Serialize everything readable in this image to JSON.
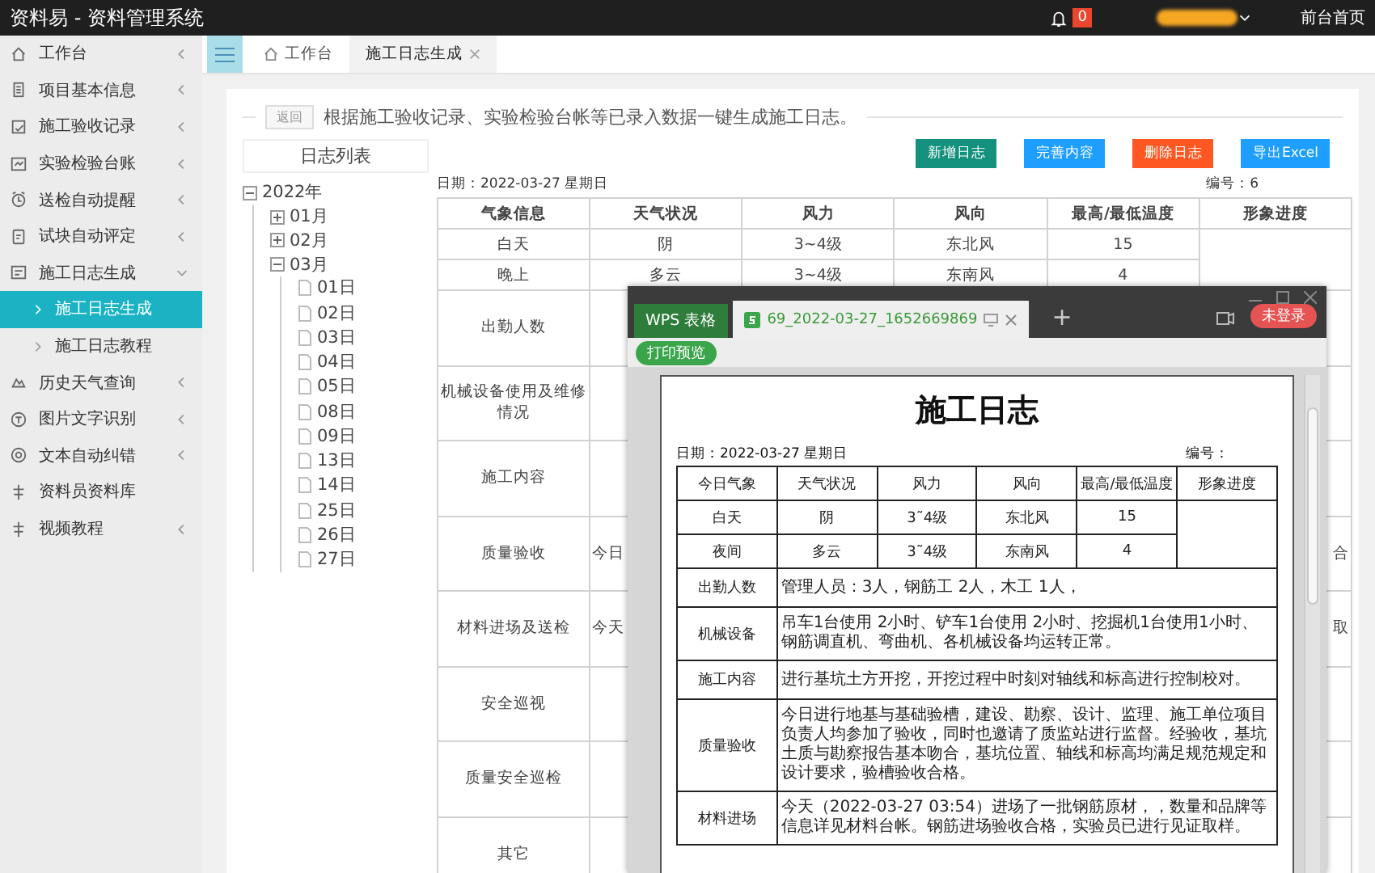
{
  "app_title": "资料易 - 资料管理系统",
  "topbar": {
    "notification_count": "0",
    "home_link": "前台首页"
  },
  "sidebar": {
    "items": [
      {
        "label": "工作台",
        "expanded": false,
        "selected": false
      },
      {
        "label": "项目基本信息",
        "expanded": false,
        "selected": false
      },
      {
        "label": "施工验收记录",
        "expanded": false,
        "selected": false
      },
      {
        "label": "实验检验台账",
        "expanded": false,
        "selected": false
      },
      {
        "label": "送检自动提醒",
        "expanded": false,
        "selected": false
      },
      {
        "label": "试块自动评定",
        "expanded": false,
        "selected": false
      },
      {
        "label": "施工日志生成",
        "expanded": true,
        "selected": false,
        "children": [
          {
            "label": "施工日志生成",
            "selected": true
          },
          {
            "label": "施工日志教程",
            "selected": false
          }
        ]
      },
      {
        "label": "历史天气查询",
        "expanded": false,
        "selected": false
      },
      {
        "label": "图片文字识别",
        "expanded": false,
        "selected": false
      },
      {
        "label": "文本自动纠错",
        "expanded": false,
        "selected": false
      },
      {
        "label": "资料员资料库",
        "selected": false
      },
      {
        "label": "视频教程",
        "expanded": false,
        "selected": false
      }
    ]
  },
  "tabs": [
    {
      "label": "工作台",
      "selected": false,
      "closable": false
    },
    {
      "label": "施工日志生成",
      "selected": true,
      "closable": true
    }
  ],
  "panel": {
    "back_button": "返回",
    "description": "根据施工验收记录、实验检验台帐等已录入数据一键生成施工日志。"
  },
  "log_list": {
    "title": "日志列表",
    "tree": [
      {
        "label": "2022年",
        "expanded": true,
        "children": [
          {
            "label": "01月",
            "expanded": false
          },
          {
            "label": "02月",
            "expanded": false
          },
          {
            "label": "03月",
            "expanded": true,
            "children": [
              {
                "label": "01日"
              },
              {
                "label": "02日"
              },
              {
                "label": "03日"
              },
              {
                "label": "04日"
              },
              {
                "label": "05日"
              },
              {
                "label": "08日"
              },
              {
                "label": "09日"
              },
              {
                "label": "13日"
              },
              {
                "label": "14日"
              },
              {
                "label": "25日"
              },
              {
                "label": "26日"
              },
              {
                "label": "27日"
              }
            ]
          }
        ]
      }
    ]
  },
  "actions": [
    {
      "label": "新增日志",
      "color": "#13917d"
    },
    {
      "label": "完善内容",
      "color": "#1e9fff"
    },
    {
      "label": "删除日志",
      "color": "#ff5722"
    },
    {
      "label": "导出Excel",
      "color": "#1e9fff"
    }
  ],
  "log": {
    "date": "日期：2022-03-27 星期日",
    "number": "编号：6",
    "weather_table": {
      "columns": [
        "气象信息",
        "天气状况",
        "风力",
        "风向",
        "最高/最低温度",
        "形象进度"
      ],
      "rows": [
        [
          "白天",
          "阴",
          "3~4级",
          "东北风",
          "15"
        ],
        [
          "晚上",
          "多云",
          "3~4级",
          "东南风",
          "4"
        ]
      ]
    },
    "sections": [
      {
        "label": "出勤人数"
      },
      {
        "label": "机械设备使用及维修情况"
      },
      {
        "label": "施工内容"
      },
      {
        "label": "质量验收",
        "content": "今日",
        "content_end": "合"
      },
      {
        "label": "材料进场及送检",
        "content": "今天",
        "content_end": "取"
      },
      {
        "label": "安全巡视"
      },
      {
        "label": "质量安全巡检"
      },
      {
        "label": "其它"
      }
    ]
  },
  "wps_window": {
    "app_tab": "WPS 表格",
    "document_tab": "69_2022-03-27_1652669869",
    "new_tab": "+",
    "login_button": "未登录",
    "print_preview_button": "打印预览",
    "document": {
      "title": "施工日志",
      "date": "日期：2022-03-27 星期日",
      "number": "编号：",
      "weather_table": {
        "columns": [
          "今日气象",
          "天气状况",
          "风力",
          "风向",
          "最高/最低温度",
          "形象进度"
        ],
        "rows": [
          [
            "白天",
            "阴",
            "3˜4级",
            "东北风",
            "15"
          ],
          [
            "夜间",
            "多云",
            "3˜4级",
            "东南风",
            "4"
          ]
        ]
      },
      "sections": [
        {
          "label": "出勤人数",
          "content": "管理人员：3人，钢筋工 2人，木工 1人，"
        },
        {
          "label": "机械设备",
          "content": "吊车1台使用 2小时、铲车1台使用 2小时、挖掘机1台使用1小时、钢筋调直机、弯曲机、各机械设备均运转正常。"
        },
        {
          "label": "施工内容",
          "content": "进行基坑土方开挖，开挖过程中时刻对轴线和标高进行控制校对。"
        },
        {
          "label": "质量验收",
          "content": "今日进行地基与基础验槽，建设、勘察、设计、监理、施工单位项目负责人均参加了验收，同时也邀请了质监站进行监督。经验收，基坑土质与勘察报告基本吻合，基坑位置、轴线和标高均满足规范规定和设计要求，验槽验收合格。"
        },
        {
          "label": "材料进场",
          "content": "今天（2022-03-27 03:54）进场了一批钢筋原材，，数量和品牌等信息详见材料台帐。钢筋进场验收合格，实验员已进行见证取样。"
        }
      ]
    }
  }
}
